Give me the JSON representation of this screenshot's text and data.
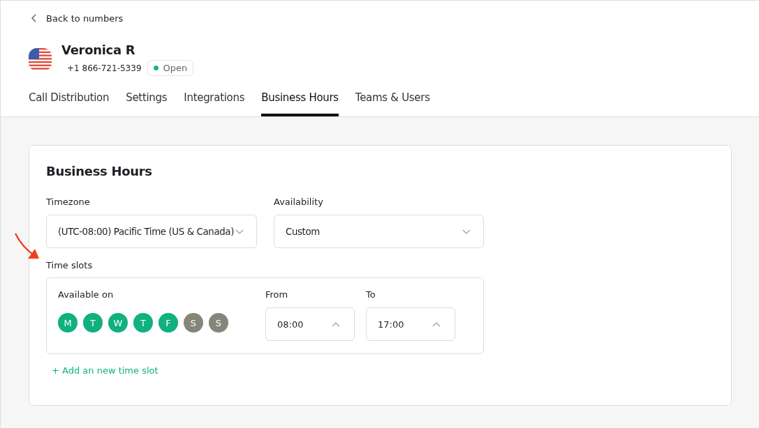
{
  "back_link": {
    "label": "Back to numbers"
  },
  "number": {
    "name": "Veronica R",
    "phone": "+1 866-721-5339",
    "status": {
      "label": "Open",
      "color": "#12b886"
    }
  },
  "tabs": [
    {
      "label": "Call Distribution",
      "selected": false
    },
    {
      "label": "Settings",
      "selected": false
    },
    {
      "label": "Integrations",
      "selected": false
    },
    {
      "label": "Business Hours",
      "selected": true
    },
    {
      "label": "Teams & Users",
      "selected": false
    }
  ],
  "card": {
    "title": "Business Hours",
    "timezone": {
      "label": "Timezone",
      "value": "(UTC-08:00) Pacific Time (US & Canada)"
    },
    "availability": {
      "label": "Availability",
      "value": "Custom"
    },
    "time_slots": {
      "label": "Time slots",
      "available_on_label": "Available on",
      "days": [
        {
          "label": "M",
          "selected": true
        },
        {
          "label": "T",
          "selected": true
        },
        {
          "label": "W",
          "selected": true
        },
        {
          "label": "T",
          "selected": true
        },
        {
          "label": "F",
          "selected": true
        },
        {
          "label": "S",
          "selected": false
        },
        {
          "label": "S",
          "selected": false
        }
      ],
      "from": {
        "label": "From",
        "value": "08:00"
      },
      "to": {
        "label": "To",
        "value": "17:00"
      }
    },
    "add_link": "+ Add an new time slot"
  }
}
